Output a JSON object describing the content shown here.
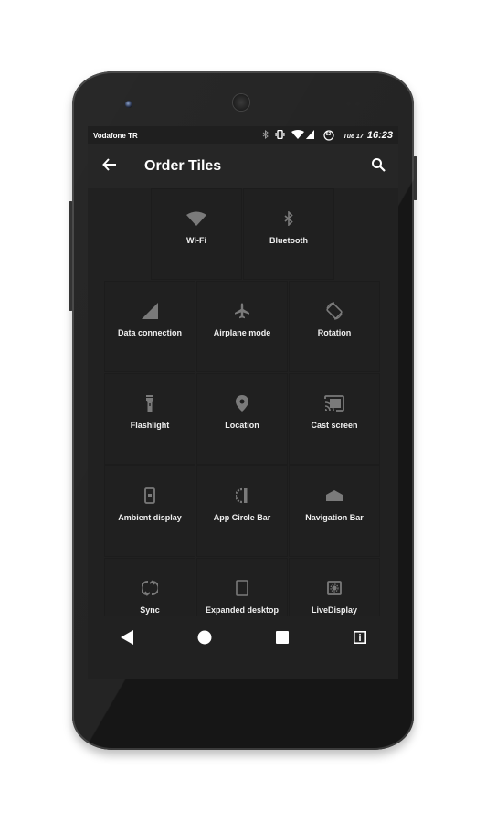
{
  "status_bar": {
    "carrier": "Vodafone TR",
    "icons": [
      "bluetooth-icon",
      "vibrate-icon",
      "wifi-icon",
      "signal-icon",
      "battery-icon"
    ],
    "battery_level": "52",
    "date": "Tue 17",
    "time": "16:23"
  },
  "toolbar": {
    "title": "Order Tiles",
    "back_icon": "arrow-back-icon",
    "search_icon": "search-icon"
  },
  "tiles": {
    "top_row": [
      {
        "label": "Wi-Fi",
        "icon": "wifi-icon"
      },
      {
        "label": "Bluetooth",
        "icon": "bluetooth-icon"
      }
    ],
    "grid": [
      {
        "label": "Data connection",
        "icon": "signal-icon"
      },
      {
        "label": "Airplane mode",
        "icon": "airplane-icon"
      },
      {
        "label": "Rotation",
        "icon": "rotation-icon"
      },
      {
        "label": "Flashlight",
        "icon": "flashlight-icon"
      },
      {
        "label": "Location",
        "icon": "location-icon"
      },
      {
        "label": "Cast screen",
        "icon": "cast-icon"
      },
      {
        "label": "Ambient display",
        "icon": "ambient-display-icon"
      },
      {
        "label": "App Circle Bar",
        "icon": "app-circle-bar-icon"
      },
      {
        "label": "Navigation Bar",
        "icon": "navigation-bar-icon"
      },
      {
        "label": "Sync",
        "icon": "sync-icon"
      },
      {
        "label": "Expanded desktop",
        "icon": "expanded-desktop-icon"
      },
      {
        "label": "LiveDisplay",
        "icon": "livedisplay-icon"
      }
    ]
  },
  "nav_bar": {
    "buttons": [
      "back-nav-icon",
      "home-icon",
      "recents-icon",
      "menu-info-icon"
    ]
  },
  "colors": {
    "screen_bg": "#212121",
    "toolbar_bg": "#262626",
    "icon_gray": "#7a7a7a",
    "text": "#ffffff"
  }
}
